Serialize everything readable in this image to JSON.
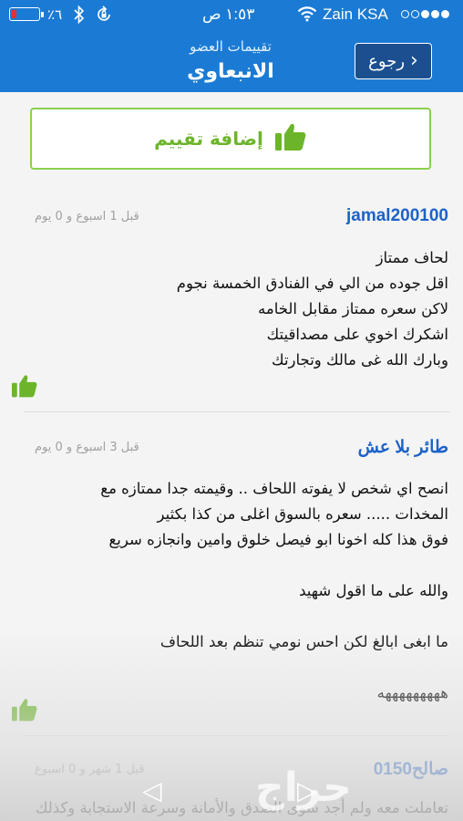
{
  "status_bar": {
    "battery_percent": "٪٦",
    "time": "١:٥٣ ص",
    "carrier": "Zain KSA",
    "signal_bars_filled": 3,
    "signal_bars_total": 5
  },
  "navbar": {
    "subtitle": "تقييمات العضو",
    "title": "الانبعاوي",
    "back_label": "رجوع"
  },
  "add_rating_label": "إضافة تقييم",
  "colors": {
    "header_blue": "#1b7bd4",
    "author_blue": "#1c62c9",
    "thumb_green": "#6cb52b",
    "battery_red": "#e8302e"
  },
  "reviews": [
    {
      "author": "jamal200100",
      "date": "قبل 1 اسبوع و 0 يوم",
      "text": "لحاف ممتاز\nاقل جوده من الي في الفنادق الخمسة نجوم\nلاكن سعره ممتاز مقابل الخامه\nاشكرك اخوي على مصداقيتك\nوبارك الله غى مالك وتجارتك",
      "icon": "thumbs-up-icon"
    },
    {
      "author": "طائر بلا عش",
      "date": "قبل 3 اسبوع و 0 يوم",
      "text": "انصح اي شخص لا يفوته اللحاف .. وقيمته جدا ممتازه مع\nالمخدات ..... سعره بالسوق اغلى من كذا بكثير\nفوق هذا كله اخونا ابو فيصل خلوق وامين وانجازه سريع\n\nوالله على ما اقول شهيد\n\nما ابغى ابالغ لكن احس نومي تنظم بعد اللحاف\n\nهههههههههه",
      "icon": "thumbs-up-icon"
    },
    {
      "author": "صالح0150",
      "date": "قبل 1 شهر و 0 اسبوع",
      "text": "تعاملت معه ولم أجد سوى الصدق والأمانة وسرعة الاستجابة وكذلك"
    }
  ],
  "watermark": "حراج"
}
